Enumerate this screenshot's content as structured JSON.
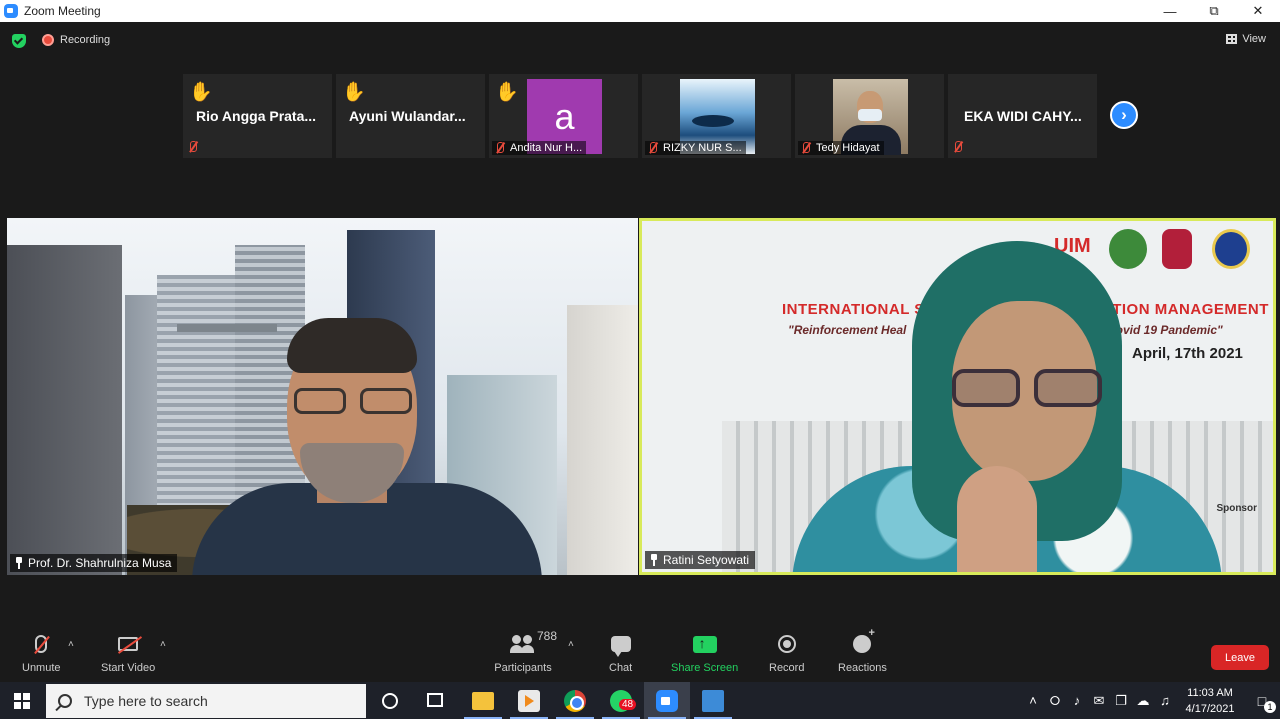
{
  "window": {
    "title": "Zoom Meeting",
    "minimize": "—",
    "restore": "⧉",
    "close": "✕"
  },
  "status": {
    "recording_label": "Recording",
    "view_label": "View"
  },
  "thumbnails": [
    {
      "name": "Rio  Angga  Prata...",
      "hand_raised": true,
      "muted": true,
      "type": "name"
    },
    {
      "name": "Ayuni  Wulandar...",
      "hand_raised": true,
      "muted": false,
      "type": "name"
    },
    {
      "name": "Andita Nur H...",
      "hand_raised": true,
      "muted": true,
      "type": "avatar",
      "avatar_letter": "a"
    },
    {
      "name": "RIZKY NUR S...",
      "hand_raised": false,
      "muted": true,
      "type": "photo"
    },
    {
      "name": "Tedy Hidayat",
      "hand_raised": false,
      "muted": true,
      "type": "photo"
    },
    {
      "name": "EKA WIDI CAHY...",
      "hand_raised": false,
      "muted": true,
      "type": "name"
    }
  ],
  "next_arrow": "›",
  "hand_glyph": "✋",
  "main_tiles": {
    "left_name": "Prof. Dr. Shahrulniza Musa",
    "right_name": "Ratini Setyowati"
  },
  "banner": {
    "title_left": "INTERNATIONAL SEM",
    "title_right": "ATION MANAGEMENT",
    "subtitle_left": "\"Reinforcement Heal",
    "subtitle_right": "e Covid 19 Pandemic\"",
    "date": "April, 17th 2021",
    "logo_text": "UIM",
    "sponsor": "Sponsor"
  },
  "toolbar": {
    "unmute": "Unmute",
    "start_video": "Start Video",
    "participants": "Participants",
    "participant_count": "788",
    "chat": "Chat",
    "share_screen": "Share Screen",
    "record": "Record",
    "reactions": "Reactions",
    "leave": "Leave",
    "caret": "˄"
  },
  "taskbar": {
    "search_placeholder": "Type here to search",
    "whatsapp_badge": "48",
    "time": "11:03 AM",
    "date": "4/17/2021",
    "notification_count": "1",
    "tray_icons": [
      "˄",
      "⭘",
      "♪",
      "✉",
      "❐",
      "☁",
      "♫"
    ]
  },
  "colors": {
    "zoom_blue": "#2d8cff",
    "active_speaker_border": "#d8ea5a",
    "share_green": "#23d160",
    "leave_red": "#d92626",
    "recording_red": "#e84b3c"
  }
}
